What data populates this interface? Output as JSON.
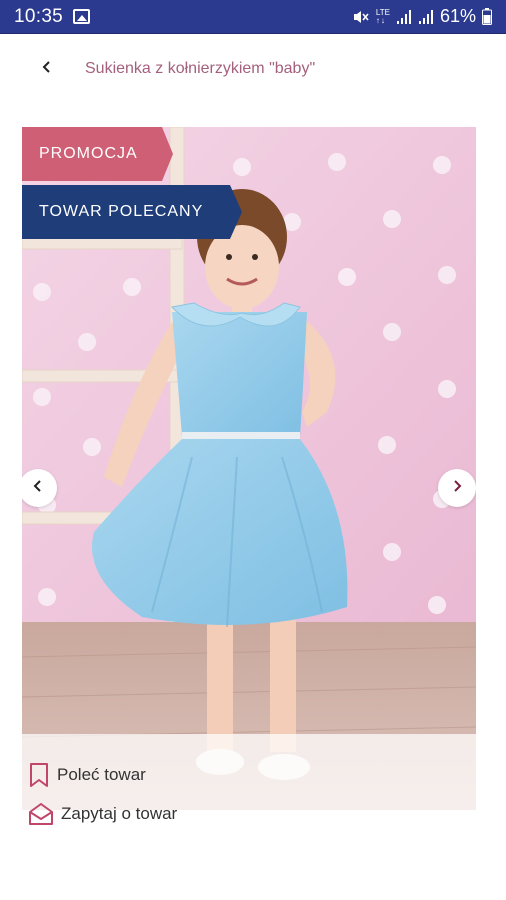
{
  "status_bar": {
    "time": "10:35",
    "network": "LTE",
    "battery": "61%",
    "icons": [
      "image-icon",
      "mute-icon",
      "lte-icon",
      "signal-icon",
      "signal-icon",
      "battery-icon"
    ]
  },
  "header": {
    "back_icon": "chevron-left-icon",
    "title": "Sukienka z kołnierzykiem \"baby\""
  },
  "product": {
    "badges": {
      "promo": "PROMOCJA",
      "featured": "TOWAR POLECANY"
    },
    "gallery_nav": {
      "prev_icon": "chevron-left-icon",
      "next_icon": "chevron-right-icon"
    }
  },
  "actions": {
    "recommend": {
      "label": "Poleć towar",
      "icon": "bookmark-icon"
    },
    "ask": {
      "label": "Zapytaj o towar",
      "icon": "envelope-open-icon"
    }
  },
  "colors": {
    "status_bar": "#2b3a8f",
    "title": "#a4607e",
    "promo_badge": "#cf5f74",
    "featured_badge": "#1e3d79",
    "action_icon": "#c0466a"
  }
}
